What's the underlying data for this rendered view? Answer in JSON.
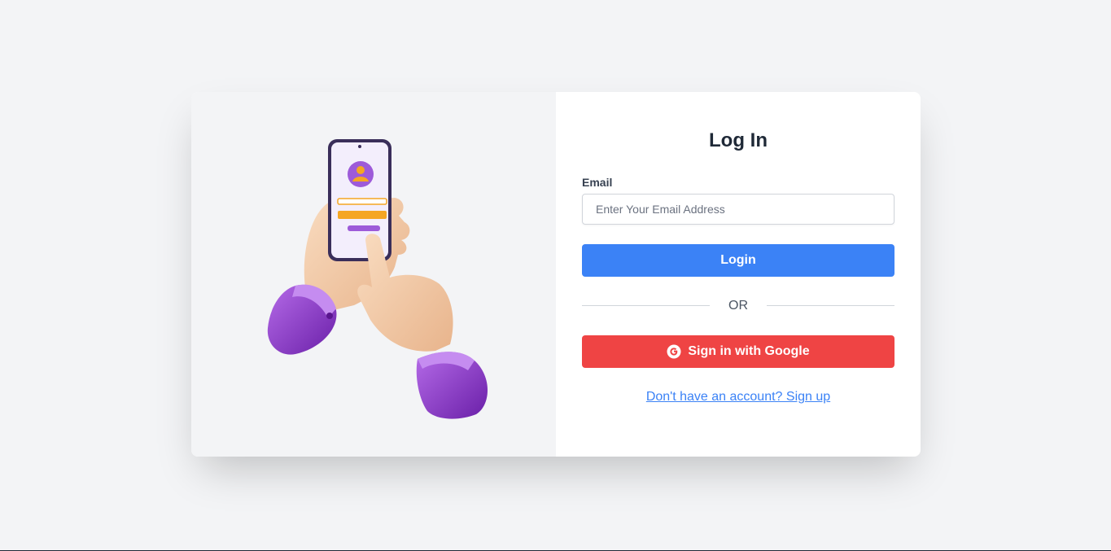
{
  "login_form": {
    "title": "Log In",
    "email_label": "Email",
    "email_placeholder": "Enter Your Email Address",
    "email_value": "",
    "login_button": "Login",
    "divider_text": "OR",
    "google_button": "Sign in with Google",
    "signup_link": "Don't have an account? Sign up"
  },
  "illustration": {
    "icon": "hands-holding-phone-login-illustration"
  },
  "icons": {
    "google": "google-g-icon"
  },
  "colors": {
    "background": "#f3f4f6",
    "primary": "#3b82f6",
    "google": "#ef4444",
    "title": "#1f2937",
    "sleeve": "#8b3fd1",
    "skin": "#f2c6a0"
  }
}
